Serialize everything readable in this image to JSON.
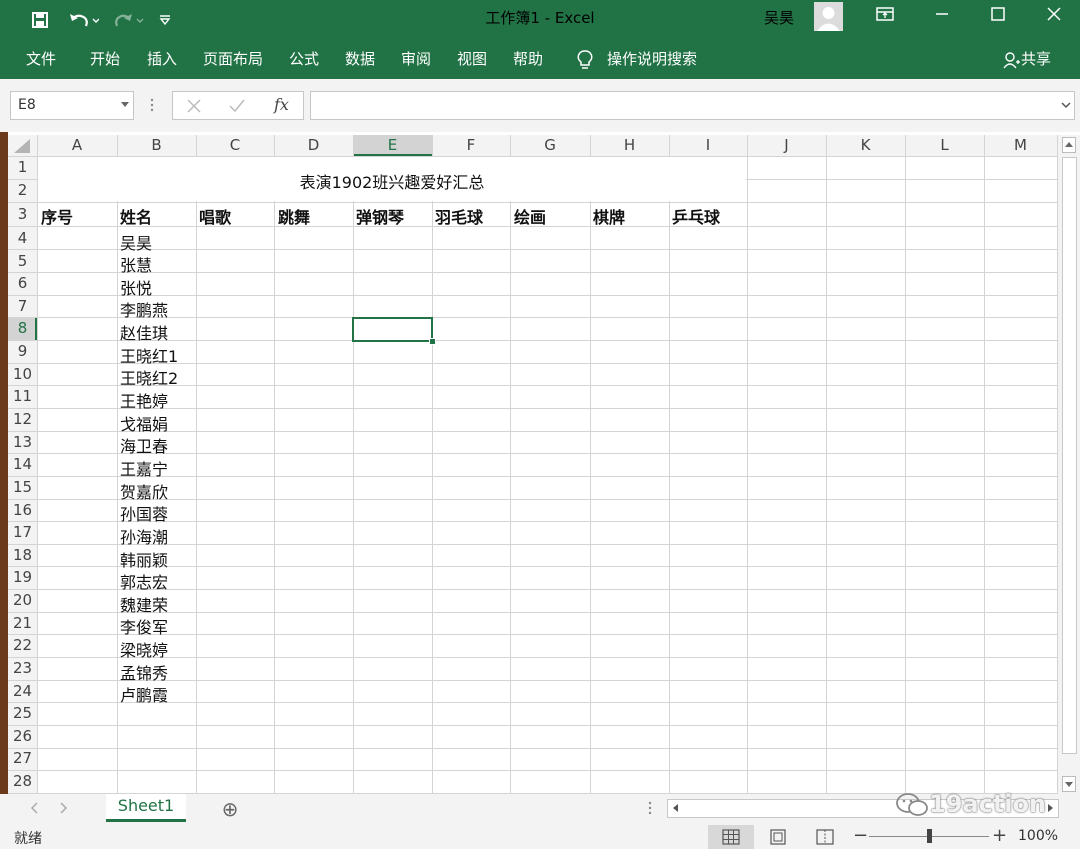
{
  "window": {
    "title": "工作簿1  -  Excel",
    "user": "吴昊",
    "icons": [
      "save-icon",
      "undo-icon",
      "redo-icon",
      "customize-icon",
      "ribbon-display-icon",
      "minimize-icon",
      "maximize-icon",
      "close-icon"
    ]
  },
  "ribbon": {
    "tabs": [
      "文件",
      "开始",
      "插入",
      "页面布局",
      "公式",
      "数据",
      "审阅",
      "视图",
      "帮助"
    ],
    "search": "操作说明搜索",
    "share": "共享"
  },
  "formula_bar": {
    "name_box": "E8",
    "fx": "fx",
    "value": ""
  },
  "columns": [
    "A",
    "B",
    "C",
    "D",
    "E",
    "F",
    "G",
    "H",
    "I",
    "J",
    "K",
    "L",
    "M"
  ],
  "rows": [
    "1",
    "2",
    "3",
    "4",
    "5",
    "6",
    "7",
    "8",
    "9",
    "10",
    "11",
    "12",
    "13",
    "14",
    "15",
    "16",
    "17",
    "18",
    "19",
    "20",
    "21",
    "22",
    "23",
    "24",
    "25",
    "26",
    "27",
    "28"
  ],
  "sheet": {
    "title": "表演1902班兴趣爱好汇总",
    "headers": [
      "序号",
      "姓名",
      "唱歌",
      "跳舞",
      "弹钢琴",
      "羽毛球",
      "绘画",
      "棋牌",
      "乒乓球"
    ],
    "names": [
      "吴昊",
      "张慧",
      "张悦",
      "李鹏燕",
      "赵佳琪",
      "王晓红1",
      "王晓红2",
      "王艳婷",
      "戈福娟",
      "海卫春",
      "王嘉宁",
      "贺嘉欣",
      "孙国蓉",
      "孙海潮",
      "韩丽颖",
      "郭志宏",
      "魏建荣",
      "李俊军",
      "梁晓婷",
      "孟锦秀",
      "卢鹏霞"
    ],
    "selected_cell": "E8"
  },
  "sheet_tabs": {
    "active": "Sheet1",
    "add": "⊕"
  },
  "watermark": "19action",
  "status": {
    "ready": "就绪",
    "zoom": "100%",
    "minus": "−",
    "plus": "+"
  },
  "colors": {
    "accent": "#217346"
  }
}
